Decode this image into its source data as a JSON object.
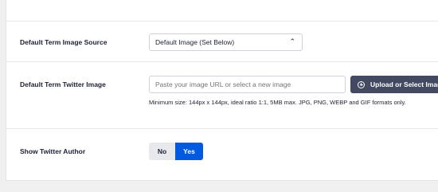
{
  "settings": {
    "image_source": {
      "label": "Default Term Image Source",
      "value": "Default Image (Set Below)"
    },
    "twitter_image": {
      "label": "Default Term Twitter Image",
      "placeholder": "Paste your image URL or select a new image",
      "upload_label": "Upload or Select Image",
      "hint": "Minimum size: 144px x 144px, ideal ratio 1:1, 5MB max. JPG, PNG, WEBP and GIF formats only."
    },
    "twitter_author": {
      "label": "Show Twitter Author",
      "no_label": "No",
      "yes_label": "Yes",
      "selected": "Yes"
    }
  },
  "colors": {
    "accent": "#005ae0",
    "button_dark": "#434960",
    "text": "#1d2033"
  },
  "icons": {
    "select_chevron": "chevron-up-icon",
    "upload": "plus-circle-icon"
  }
}
